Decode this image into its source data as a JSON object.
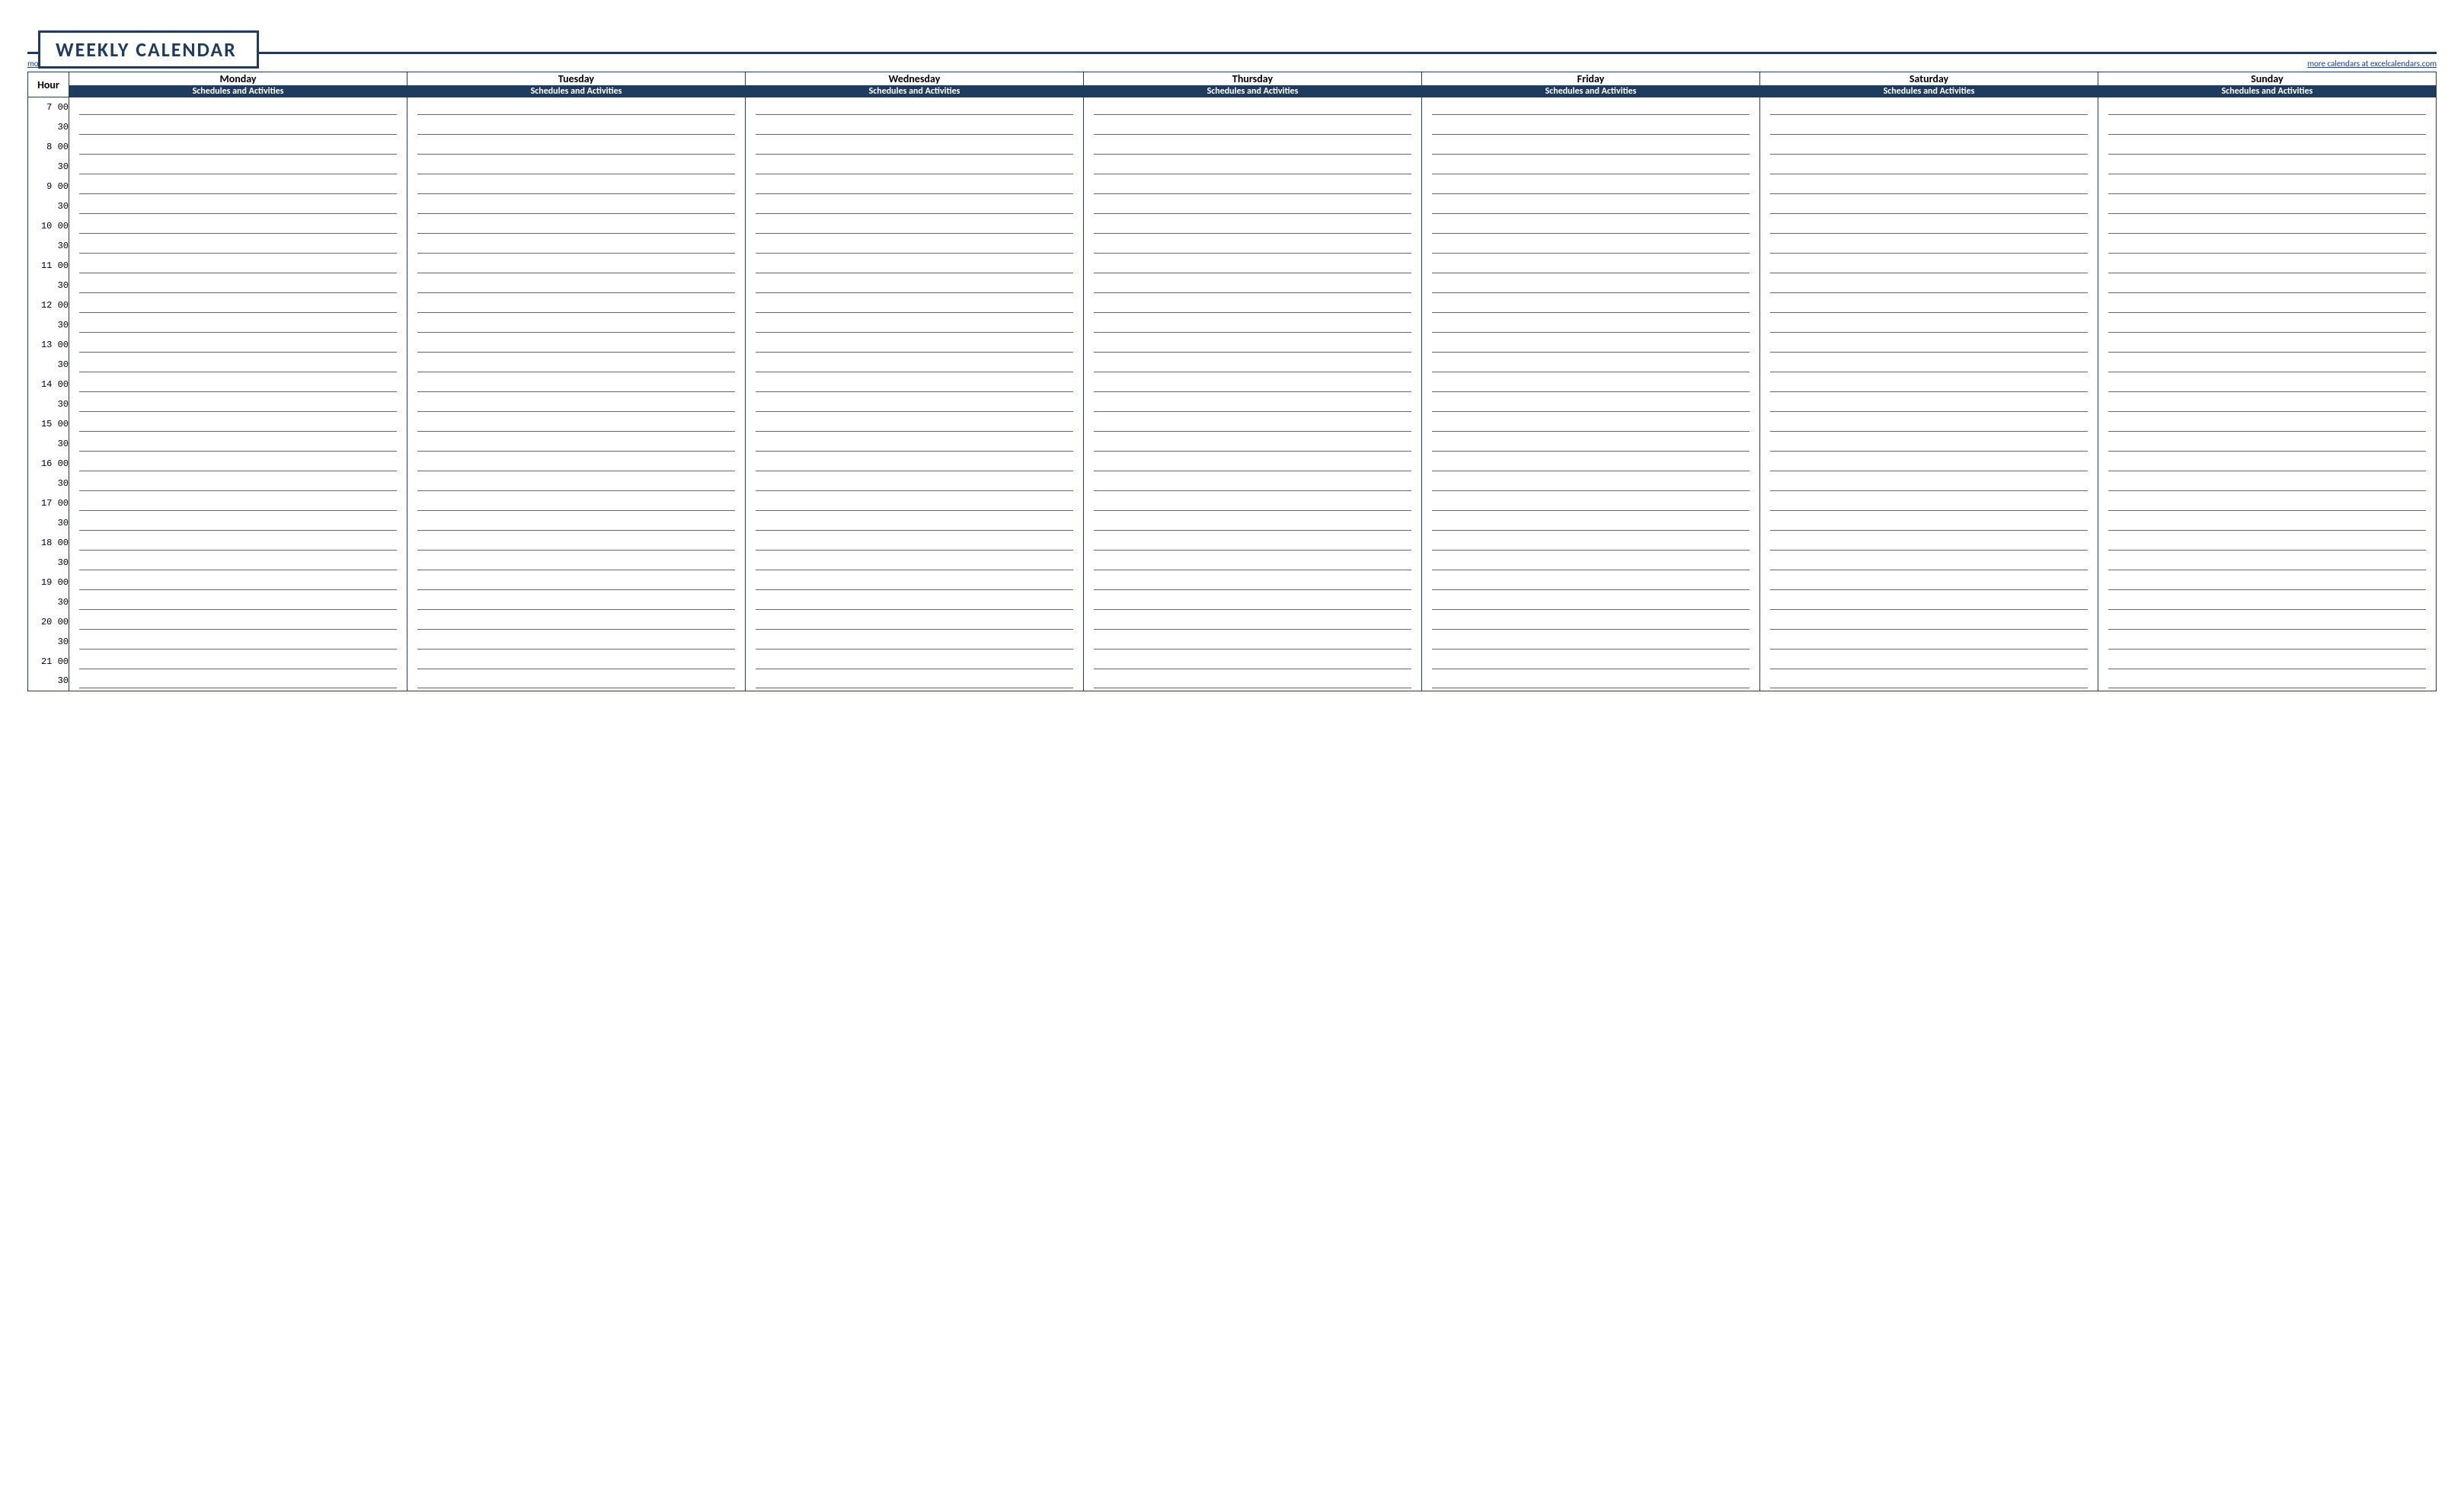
{
  "title": "WEEKLY CALENDAR",
  "link_left": "more templates at exceltemplate.net",
  "link_right": "more calendars at excelcalendars.com",
  "hour_header": "Hour",
  "days": [
    "Monday",
    "Tuesday",
    "Wednesday",
    "Thursday",
    "Friday",
    "Saturday",
    "Sunday"
  ],
  "subheader": "Schedules and Activities",
  "hours": [
    7,
    8,
    9,
    10,
    11,
    12,
    13,
    14,
    15,
    16,
    17,
    18,
    19,
    20,
    21
  ],
  "half_label": "30",
  "minute_label": "00"
}
